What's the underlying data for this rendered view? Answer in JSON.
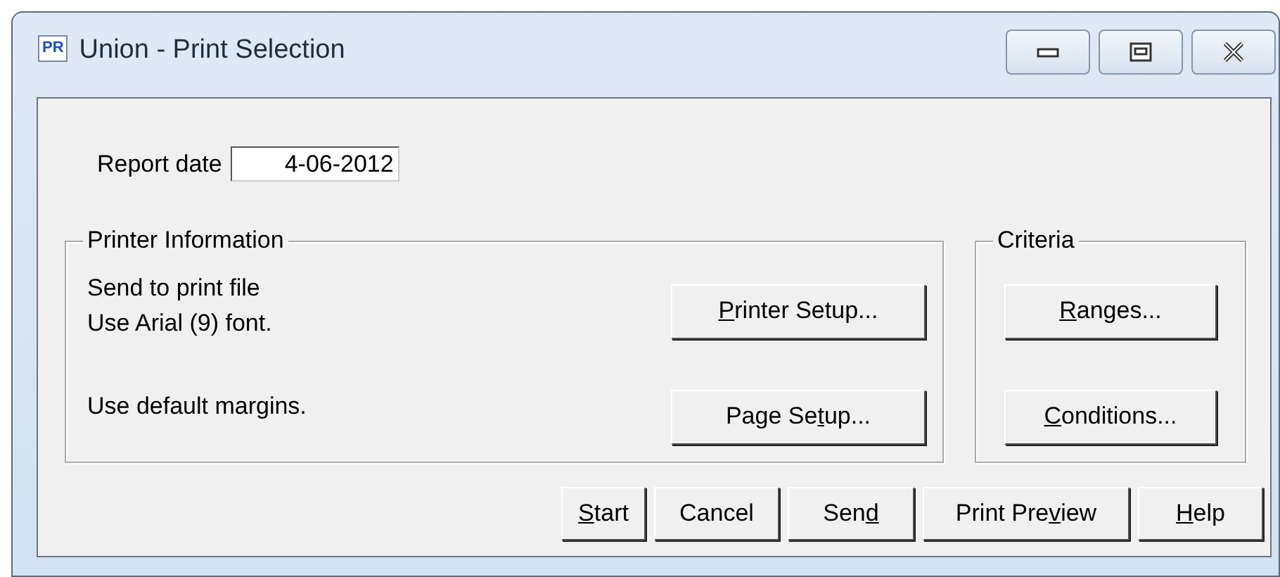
{
  "window": {
    "icon_text": "PR",
    "title": "Union - Print Selection",
    "controls": [
      {
        "kind": "minimize"
      },
      {
        "kind": "maximize"
      },
      {
        "kind": "close"
      }
    ]
  },
  "report_date": {
    "label": "Report date",
    "value": "4-06-2012"
  },
  "printer_information": {
    "title": "Printer Information",
    "lines": [
      "Send to print file",
      "Use Arial (9) font.",
      "Use default margins."
    ],
    "buttons": [
      {
        "key": "P",
        "post": "rinter Setup..."
      },
      {
        "pre": "Page Se",
        "key": "t",
        "post": "up..."
      }
    ]
  },
  "criteria": {
    "title": "Criteria",
    "buttons": [
      {
        "key": "R",
        "post": "anges..."
      },
      {
        "key": "C",
        "post": "onditions..."
      }
    ]
  },
  "buttons": [
    {
      "key": "S",
      "post": "tart"
    },
    {
      "pre": "Cancel"
    },
    {
      "pre": "Sen",
      "key": "d"
    },
    {
      "pre": "Print Pre",
      "key": "v",
      "post": "iew"
    },
    {
      "key": "H",
      "post": "elp"
    }
  ]
}
